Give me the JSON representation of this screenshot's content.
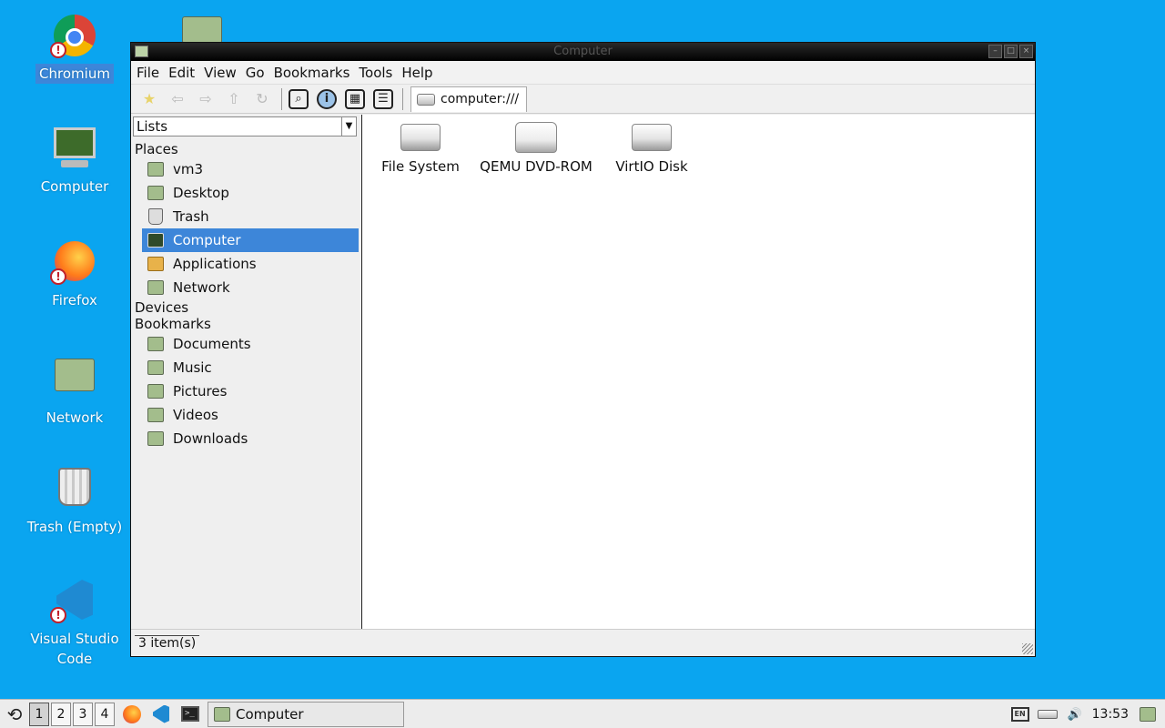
{
  "desktop": {
    "icons": [
      {
        "label": "Chromium"
      },
      {
        "label": "Computer"
      },
      {
        "label": "Firefox"
      },
      {
        "label": "Network"
      },
      {
        "label": "Trash (Empty)"
      },
      {
        "label": "Visual Studio Code"
      }
    ]
  },
  "window": {
    "title": "Computer",
    "menu": [
      "File",
      "Edit",
      "View",
      "Go",
      "Bookmarks",
      "Tools",
      "Help"
    ],
    "location": "computer:///",
    "sidebar": {
      "mode": "Lists",
      "sections": {
        "places": "Places",
        "devices": "Devices",
        "bookmarks": "Bookmarks"
      },
      "places": [
        "vm3",
        "Desktop",
        "Trash",
        "Computer",
        "Applications",
        "Network"
      ],
      "bookmarks": [
        "Documents",
        "Music",
        "Pictures",
        "Videos",
        "Downloads"
      ],
      "active": "Computer"
    },
    "items": [
      "File System",
      "QEMU DVD-ROM",
      "VirtIO Disk"
    ],
    "status": "3 item(s)"
  },
  "taskbar": {
    "workspaces": [
      "1",
      "2",
      "3",
      "4"
    ],
    "active_workspace": "1",
    "task_label": "Computer",
    "clock": "13:53"
  },
  "colors": {
    "desktop": "#0aa5f0",
    "selection": "#3d86d9"
  }
}
